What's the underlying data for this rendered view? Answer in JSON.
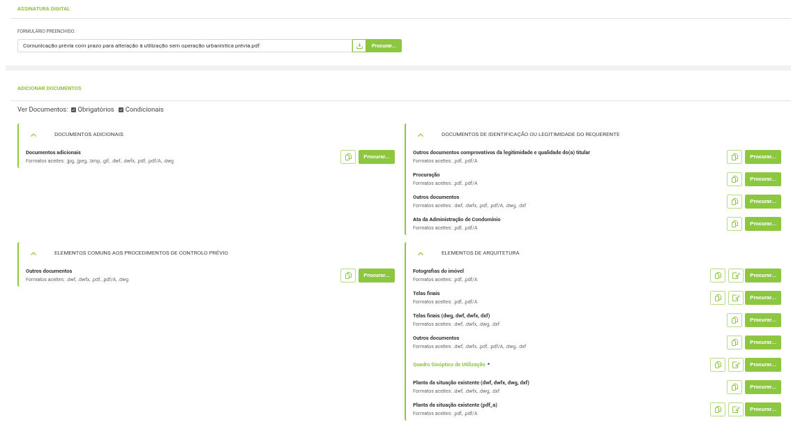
{
  "signature": {
    "title": "ASSINATURA DIGITAL",
    "field_label": "FORMULÁRIO PREENCHIDO:",
    "file_value": "Comunicação prévia com prazo para alteração à utilização sem operação urbanística prévia.pdf",
    "browse_label": "Procurar..."
  },
  "documents": {
    "title": "ADICIONAR DOCUMENTOS",
    "filter_label": "Ver Documentos:",
    "filters": [
      {
        "label": "Obrigatórios",
        "checked": true
      },
      {
        "label": "Condicionais",
        "checked": true
      }
    ],
    "panels": [
      {
        "title": "DOCUMENTOS ADICIONAIS",
        "expanded": true,
        "items": [
          {
            "title": "Documentos adicionais",
            "formats": "Formatos aceites: .jpg, .jpeg, .bmp, .gif, .dwf, .dwfx, .pdf, .pdf/A, .dwg",
            "signable": false,
            "required": false,
            "browse_label": "Procurar..."
          }
        ]
      },
      {
        "title": "DOCUMENTOS DE IDENTIFICAÇÃO OU LEGITIMIDADE DO REQUERENTE",
        "expanded": true,
        "items": [
          {
            "title": "Outros documentos comprovativos da legitimidade e qualidade do(a) titular",
            "formats": "Formatos aceites: .pdf, .pdf/A",
            "signable": false,
            "required": false,
            "browse_label": "Procurar..."
          },
          {
            "title": "Procuração",
            "formats": "Formatos aceites: .pdf, .pdf/A",
            "signable": false,
            "required": false,
            "browse_label": "Procurar..."
          },
          {
            "title": "Outros documentos",
            "formats": "Formatos aceites: .dwf, .dwfx, .pdf, .pdf/A, .dwg, .dxf",
            "signable": false,
            "required": false,
            "browse_label": "Procurar..."
          },
          {
            "title": "Ata da Administração de Condomínio",
            "formats": "Formatos aceites: .pdf, .pdf/A",
            "signable": false,
            "required": false,
            "browse_label": "Procurar..."
          }
        ]
      },
      {
        "title": "ELEMENTOS COMUNS AOS PROCEDIMENTOS DE CONTROLO PRÉVIO",
        "expanded": true,
        "items": [
          {
            "title": "Outros documentos",
            "formats": "Formatos aceites: .dwf, .dwfx, .pdf, .pdf/A, .dwg",
            "signable": false,
            "required": false,
            "browse_label": "Procurar..."
          }
        ]
      },
      {
        "title": "ELEMENTOS DE ARQUITETURA",
        "expanded": true,
        "items": [
          {
            "title": "Fotografias do imóvel",
            "formats": "Formatos aceites: .pdf, .pdf/A",
            "signable": true,
            "required": false,
            "browse_label": "Procurar..."
          },
          {
            "title": "Telas finais",
            "formats": "Formatos aceites: .pdf, .pdf/A",
            "signable": true,
            "required": false,
            "browse_label": "Procurar..."
          },
          {
            "title": "Telas finais (dwg, dwf, dwfx, dxf)",
            "formats": "Formatos aceites: .dwf, .dwfx, .dwg, .dxf",
            "signable": false,
            "required": false,
            "browse_label": "Procurar..."
          },
          {
            "title": "Outros documentos",
            "formats": "Formatos aceites: .dwf, .dwfx, .pdf, .pdf/A, .dwg, .dxf",
            "signable": false,
            "required": false,
            "browse_label": "Procurar..."
          },
          {
            "title": "Quadro Sinóptico de Utilização",
            "required_mark": "*",
            "signable": true,
            "required": true,
            "browse_label": "Procurar..."
          },
          {
            "title": "Planta da situação existente (dwf, dwfx, dwg, dxf)",
            "formats": "Formatos aceites: .dwf, .dwfx, .dwg, .dxf",
            "signable": false,
            "required": false,
            "browse_label": "Procurar..."
          },
          {
            "title": "Planta da situação existente (pdf_a)",
            "formats": "Formatos aceites: .pdf, .pdf/A",
            "signable": true,
            "required": false,
            "browse_label": "Procurar..."
          }
        ]
      }
    ]
  }
}
